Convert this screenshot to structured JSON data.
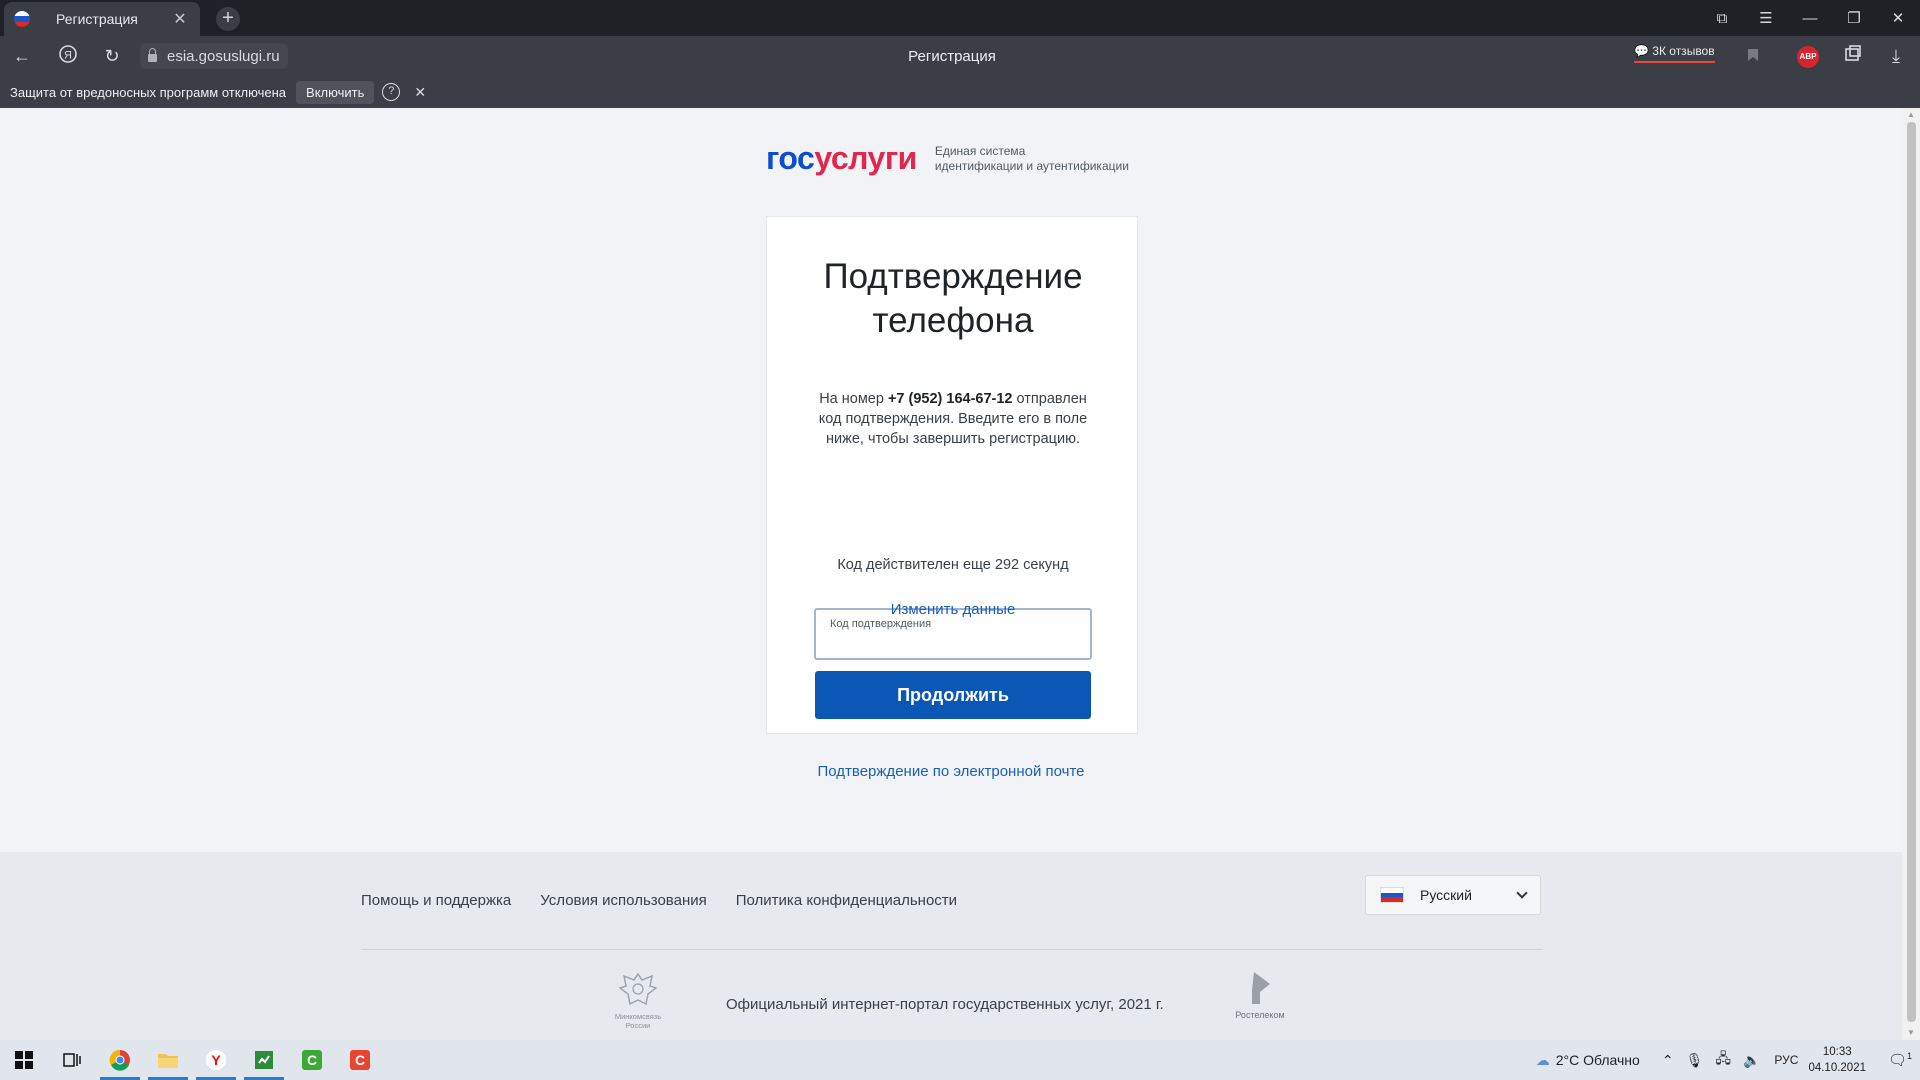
{
  "browser": {
    "tab_title": "Регистрация",
    "tab_close": "✕",
    "new_tab": "+",
    "address": "esia.gosuslugi.ru",
    "page_title": "Регистрация",
    "reviews": "3К отзывов",
    "abp": "ABP",
    "window_controls": [
      "⧉",
      "☰",
      "—",
      "❐",
      "✕"
    ]
  },
  "infobar": {
    "text": "Защита от вредоносных программ отключена",
    "enable": "Включить",
    "help": "?",
    "close": "✕"
  },
  "logo": {
    "part1": "гос",
    "part2": "услуги",
    "subtitle_line1": "Единая система",
    "subtitle_line2": "идентификации и аутентификации"
  },
  "card": {
    "title_line1": "Подтверждение",
    "title_line2": "телефона",
    "desc_prefix": "На номер",
    "phone": "+7 (952) 164-67-12",
    "desc_rest": "отправлен код подтверждения. Введите его в поле ниже, чтобы завершить регистрацию.",
    "code_label": "Код подтверждения",
    "code_value": "",
    "continue_button": "Продолжить",
    "timer": "Код действителен еще 292 секунд",
    "change_data": "Изменить данные"
  },
  "email_confirm_link": "Подтверждение по электронной почте",
  "footer": {
    "links": [
      "Помощь и поддержка",
      "Условия использования",
      "Политика конфиденциальности"
    ],
    "language": "Русский",
    "ministry_line1": "Минкомсвязь",
    "ministry_line2": "России",
    "copyright": "Официальный интернет-портал государственных услуг, 2021 г.",
    "rt_label": "Ростелеком"
  },
  "taskbar": {
    "weather": "2°C  Облачно",
    "lang": "РУС",
    "time": "10:33",
    "date": "04.10.2021",
    "notifications": "1"
  },
  "colors": {
    "brand_blue": "#0d4cd3",
    "brand_red": "#e3264d",
    "button_blue": "#0a57b5",
    "link_blue": "#1a5fb4"
  }
}
